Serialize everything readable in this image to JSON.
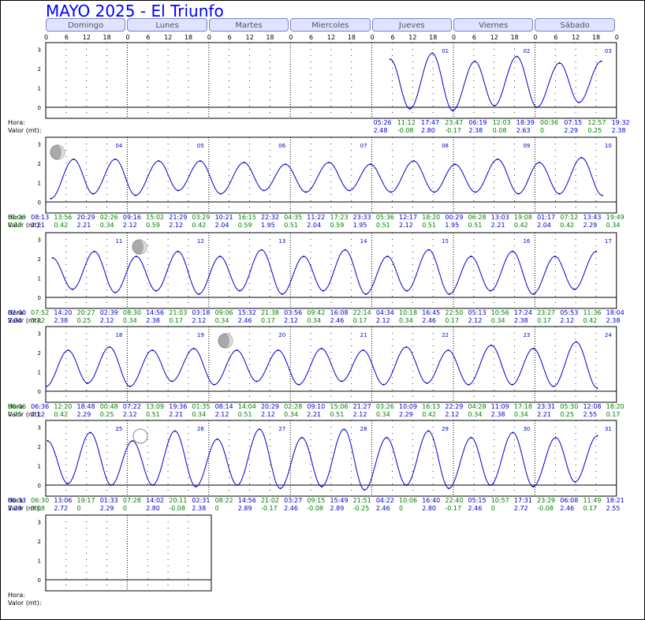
{
  "title": "MAYO 2025 - El Triunfo",
  "weekdays": [
    "Domingo",
    "Lunes",
    "Martes",
    "Miercoles",
    "Jueves",
    "Viernes",
    "Sábado"
  ],
  "hour_ticks": [
    "0",
    "6",
    "12",
    "18"
  ],
  "row_labels": {
    "hora": "Hora:",
    "valor": "Valor (mt):"
  },
  "colors": {
    "title": "#0000ff",
    "curve": "#0000cc",
    "high": "#0000cc",
    "low": "#008000",
    "button": "#dfe3ff"
  },
  "chart_data": {
    "type": "line",
    "title": "MAYO 2025 - El Triunfo",
    "ylabel": "Valor (mt)",
    "xlabel": "Hora",
    "ylim": [
      -0.3,
      3.3
    ],
    "y_ticks": [
      "0",
      "1",
      "2",
      "3"
    ],
    "weeks": [
      {
        "days": [
          "",
          "",
          "",
          "",
          "01",
          "02",
          "03"
        ],
        "events": [
          [
            "05:26",
            "2.48"
          ],
          [
            "11:12",
            "-0.08"
          ],
          [
            "17:47",
            "2.80"
          ],
          [
            "23:47",
            "-0.17"
          ],
          [
            "06:19",
            "2.38"
          ],
          [
            "12:03",
            "0.08"
          ],
          [
            "18:39",
            "2.63"
          ],
          [
            "00:36",
            "0"
          ],
          [
            "07:15",
            "2.29"
          ],
          [
            "12:57",
            "0.25"
          ],
          [
            "19:32",
            "2.38"
          ]
        ],
        "event_days": [
          4,
          4,
          4,
          4,
          5,
          5,
          5,
          6,
          6,
          6,
          6
        ]
      },
      {
        "days": [
          "04",
          "05",
          "06",
          "07",
          "08",
          "09",
          "10"
        ],
        "events": [
          [
            "01:29",
            "0.17"
          ],
          [
            "08:13",
            "2.21"
          ],
          [
            "13:56",
            "0.42"
          ],
          [
            "20:29",
            "2.21"
          ],
          [
            "02:26",
            "0.34"
          ],
          [
            "09:16",
            "2.12"
          ],
          [
            "15:02",
            "0.59"
          ],
          [
            "21:29",
            "2.12"
          ],
          [
            "03:29",
            "0.42"
          ],
          [
            "10:21",
            "2.04"
          ],
          [
            "16:15",
            "0.59"
          ],
          [
            "22:32",
            "1.95"
          ],
          [
            "04:35",
            "0.51"
          ],
          [
            "11:22",
            "2.04"
          ],
          [
            "17:23",
            "0.59"
          ],
          [
            "23:33",
            "1.95"
          ],
          [
            "05:36",
            "0.51"
          ],
          [
            "12:17",
            "2.12"
          ],
          [
            "18:20",
            "0.51"
          ],
          [
            "00:29",
            "1.95"
          ],
          [
            "06:28",
            "0.51"
          ],
          [
            "13:03",
            "2.21"
          ],
          [
            "19:08",
            "0.42"
          ],
          [
            "01:17",
            "2.04"
          ],
          [
            "07:12",
            "0.42"
          ],
          [
            "13:43",
            "2.29"
          ],
          [
            "19:49",
            "0.34"
          ]
        ],
        "event_days": [
          0,
          0,
          0,
          0,
          1,
          1,
          1,
          1,
          2,
          2,
          2,
          2,
          3,
          3,
          3,
          3,
          4,
          4,
          4,
          5,
          5,
          5,
          5,
          6,
          6,
          6,
          6
        ]
      },
      {
        "days": [
          "11",
          "12",
          "13",
          "14",
          "15",
          "16",
          "17"
        ],
        "events": [
          [
            "02:00",
            "2.04"
          ],
          [
            "07:52",
            "0.42"
          ],
          [
            "14:20",
            "2.38"
          ],
          [
            "20:27",
            "0.25"
          ],
          [
            "02:39",
            "2.12"
          ],
          [
            "08:30",
            "0.34"
          ],
          [
            "14:56",
            "2.38"
          ],
          [
            "21:03",
            "0.17"
          ],
          [
            "03:18",
            "2.12"
          ],
          [
            "09:06",
            "0.34"
          ],
          [
            "15:32",
            "2.46"
          ],
          [
            "21:38",
            "0.17"
          ],
          [
            "03:56",
            "2.12"
          ],
          [
            "09:42",
            "0.34"
          ],
          [
            "16:08",
            "2.46"
          ],
          [
            "22:14",
            "0.17"
          ],
          [
            "04:34",
            "2.12"
          ],
          [
            "10:18",
            "0.34"
          ],
          [
            "16:45",
            "2.46"
          ],
          [
            "22:50",
            "0.17"
          ],
          [
            "05:13",
            "2.12"
          ],
          [
            "10:56",
            "0.34"
          ],
          [
            "17:24",
            "2.38"
          ],
          [
            "23:27",
            "0.17"
          ],
          [
            "05:53",
            "2.12"
          ],
          [
            "11:36",
            "0.42"
          ],
          [
            "18:04",
            "2.38"
          ]
        ],
        "event_days": [
          0,
          0,
          0,
          0,
          1,
          1,
          1,
          1,
          2,
          2,
          2,
          2,
          3,
          3,
          3,
          3,
          4,
          4,
          4,
          4,
          5,
          5,
          5,
          5,
          6,
          6,
          6
        ]
      },
      {
        "days": [
          "18",
          "19",
          "20",
          "21",
          "22",
          "23",
          "24"
        ],
        "events": [
          [
            "00:06",
            "0.25"
          ],
          [
            "06:36",
            "2.12"
          ],
          [
            "12:20",
            "0.42"
          ],
          [
            "18:48",
            "2.29"
          ],
          [
            "00:48",
            "0.25"
          ],
          [
            "07:22",
            "2.12"
          ],
          [
            "13:09",
            "0.51"
          ],
          [
            "19:36",
            "2.21"
          ],
          [
            "01:35",
            "0.34"
          ],
          [
            "08:14",
            "2.12"
          ],
          [
            "14:04",
            "0.51"
          ],
          [
            "20:29",
            "2.12"
          ],
          [
            "02:28",
            "0.34"
          ],
          [
            "09:10",
            "2.21"
          ],
          [
            "15:06",
            "0.51"
          ],
          [
            "21:27",
            "2.12"
          ],
          [
            "03:26",
            "0.34"
          ],
          [
            "10:09",
            "2.29"
          ],
          [
            "16:13",
            "0.42"
          ],
          [
            "22:29",
            "2.12"
          ],
          [
            "04:28",
            "0.34"
          ],
          [
            "11:09",
            "2.38"
          ],
          [
            "17:18",
            "0.34"
          ],
          [
            "23:31",
            "2.21"
          ],
          [
            "05:30",
            "0.25"
          ],
          [
            "12:08",
            "2.55"
          ],
          [
            "18:20",
            "0.17"
          ]
        ],
        "event_days": [
          0,
          0,
          0,
          0,
          1,
          1,
          1,
          1,
          2,
          2,
          2,
          2,
          3,
          3,
          3,
          3,
          4,
          4,
          4,
          4,
          5,
          5,
          5,
          5,
          6,
          6,
          6
        ]
      },
      {
        "days": [
          "25",
          "26",
          "27",
          "28",
          "29",
          "30",
          "31"
        ],
        "events": [
          [
            "00:33",
            "2.29"
          ],
          [
            "06:30",
            "0.08"
          ],
          [
            "13:06",
            "2.72"
          ],
          [
            "19:17",
            "0"
          ],
          [
            "01:33",
            "2.29"
          ],
          [
            "07:28",
            "0"
          ],
          [
            "14:02",
            "2.80"
          ],
          [
            "20:11",
            "-0.08"
          ],
          [
            "02:31",
            "2.38"
          ],
          [
            "08:22",
            "0"
          ],
          [
            "14:56",
            "2.89"
          ],
          [
            "21:02",
            "-0.17"
          ],
          [
            "03:27",
            "2.46"
          ],
          [
            "09:15",
            "-0.08"
          ],
          [
            "15:49",
            "2.89"
          ],
          [
            "21:51",
            "-0.25"
          ],
          [
            "04:22",
            "2.46"
          ],
          [
            "10:06",
            "0"
          ],
          [
            "16:40",
            "2.80"
          ],
          [
            "22:40",
            "-0.17"
          ],
          [
            "05:15",
            "2.46"
          ],
          [
            "10:57",
            "0"
          ],
          [
            "17:31",
            "2.72"
          ],
          [
            "23:29",
            "-0.08"
          ],
          [
            "06:08",
            "2.46"
          ],
          [
            "11:49",
            "0.17"
          ],
          [
            "18:21",
            "2.55"
          ]
        ],
        "event_days": [
          0,
          0,
          0,
          0,
          1,
          1,
          1,
          1,
          2,
          2,
          2,
          2,
          3,
          3,
          3,
          3,
          4,
          4,
          4,
          4,
          5,
          5,
          5,
          5,
          6,
          6,
          6
        ]
      },
      {
        "days": [
          "",
          "",
          "",
          "",
          "",
          "",
          ""
        ],
        "events": [],
        "event_days": []
      }
    ]
  }
}
